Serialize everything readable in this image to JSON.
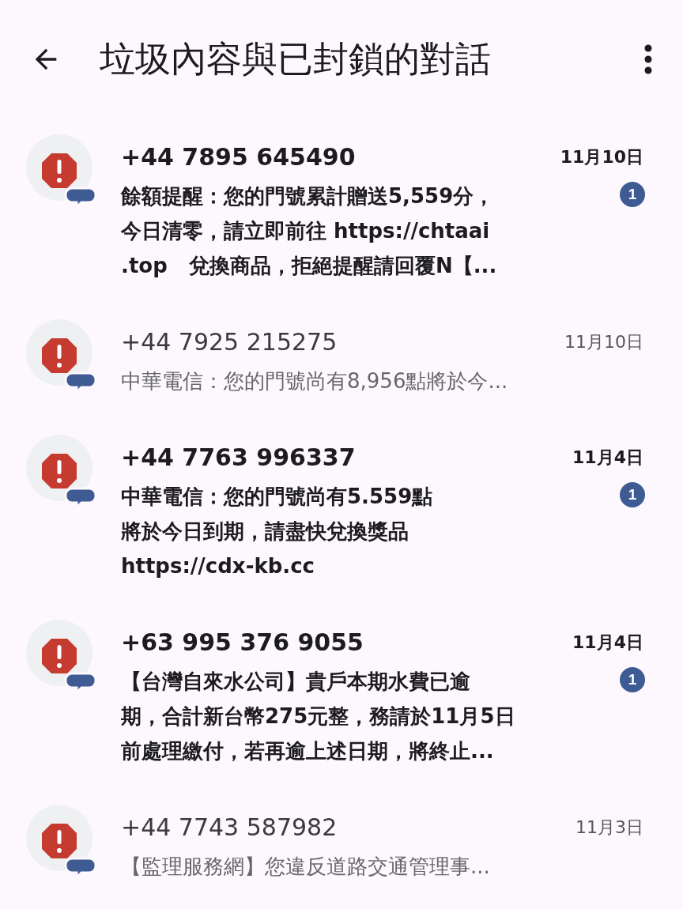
{
  "header": {
    "title": "垃圾內容與已封鎖的對話"
  },
  "conversations": [
    {
      "sender": "+44 7895 645490",
      "date": "11月10日",
      "unread": true,
      "badge": "1",
      "preview": [
        "餘額提醒：您的門號累計贈送5,559分，",
        "今日清零，請立即前往 https://chtaai",
        ".top   兌換商品，拒絕提醒請回覆N【..."
      ]
    },
    {
      "sender": "+44 7925 215275",
      "date": "11月10日",
      "unread": false,
      "preview": [
        "中華電信：您的門號尚有8,956點將於今..."
      ]
    },
    {
      "sender": "+44 7763 996337",
      "date": "11月4日",
      "unread": true,
      "badge": "1",
      "preview": [
        "中華電信：您的門號尚有5.559點",
        "將於今日到期，請盡快兌換獎品",
        "https://cdx-kb.cc"
      ]
    },
    {
      "sender": "+63 995 376 9055",
      "date": "11月4日",
      "unread": true,
      "badge": "1",
      "preview": [
        "【台灣自來水公司】貴戶本期水費已逾",
        "期，合計新台幣275元整，務請於11月5日",
        "前處理繳付，若再逾上述日期，將終止..."
      ]
    },
    {
      "sender": "+44 7743 587982",
      "date": "11月3日",
      "unread": false,
      "preview": [
        "【監理服務網】您違反道路交通管理事..."
      ]
    }
  ]
}
